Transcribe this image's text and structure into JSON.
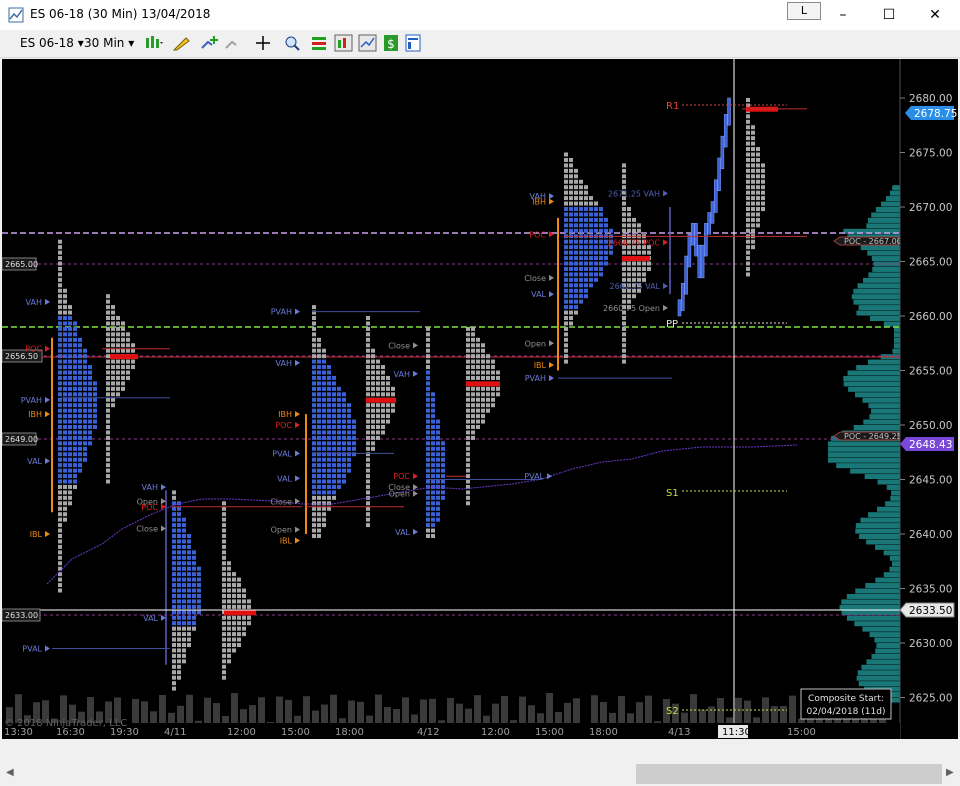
{
  "window": {
    "title": "ES 06-18 (30 Min)  13/04/2018",
    "link_button": "L",
    "minimize": "–",
    "maximize": "☐",
    "close": "✕"
  },
  "toolbar": {
    "instrument": "ES 06-18",
    "interval": "30 Min",
    "icons": [
      "bar-chart-style-icon",
      "drawing-tool-icon",
      "add-indicator-icon",
      "remove-indicator-icon",
      "crosshair-icon",
      "zoom-icon",
      "strategies-icon",
      "data-series-icon",
      "chart-trader-icon",
      "dollar-icon",
      "properties-icon"
    ]
  },
  "chart": {
    "copyright": "© 2018 NinjaTrader, LLC",
    "price_axis": [
      "2680.00",
      "2675.00",
      "2670.00",
      "2665.00",
      "2660.00",
      "2655.00",
      "2650.00",
      "2645.00",
      "2640.00",
      "2635.00",
      "2630.00",
      "2625.00"
    ],
    "price_badges": {
      "last": "2678.75",
      "vwap": "2648.43",
      "crosshair": "2633.50"
    },
    "time_axis": [
      "13:30",
      "16:30",
      "19:30",
      "4/11",
      "12:00",
      "15:00",
      "18:00",
      "4/12",
      "12:00",
      "15:00",
      "18:00",
      "4/13",
      "11:30",
      "15:00"
    ],
    "time_cursor": "11:30",
    "left_price_tags": [
      "2665.00",
      "2656.50",
      "2649.00",
      "2633.00"
    ],
    "composite_poc": [
      "POC - 2667.00",
      "POC - 2649.25"
    ],
    "pivots": [
      "R1",
      "PP",
      "S1",
      "S2"
    ],
    "composite_start_title": "Composite Start:",
    "composite_start_value": "02/04/2018 (11d)",
    "labels": {
      "vah": "VAH",
      "val": "VAL",
      "poc": "POC",
      "pvah": "PVAH",
      "pval": "PVAL",
      "ibh": "IBH",
      "ibl": "IBL",
      "open": "Open",
      "close": "Close",
      "d4_vah": "2671.25 VAH",
      "d4_poc": "2666.75 POC",
      "d4_val": "2662.75 VAL",
      "d4_open": "2660.75 Open"
    },
    "colors": {
      "background": "#000000",
      "value_area": "#3a62d6",
      "outside_va": "#a8a8a8",
      "poc": "#e01010",
      "composite": "#1e8c8c",
      "ib": "#f08a10",
      "vwap": "#6a3ad0",
      "last_badge": "#2a8ee8",
      "vwap_badge": "#7a48d8"
    }
  },
  "scrollbar": {
    "left_arrow": "◀",
    "right_arrow": "▶"
  }
}
